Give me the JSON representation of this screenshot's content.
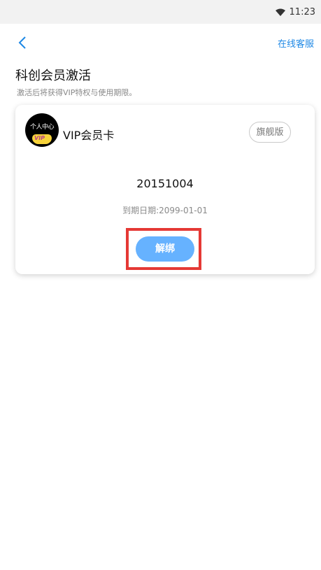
{
  "status_bar": {
    "time": "11:23",
    "wifi_icon": "wifi-icon"
  },
  "nav": {
    "back_icon": "chevron-left-icon",
    "service_label": "在线客服",
    "accent_color": "#1e88e5"
  },
  "page": {
    "title": "科创会员激活",
    "subtitle": "激活后将获得VIP特权与使用期限。"
  },
  "card": {
    "avatar": {
      "text": "个人中心",
      "badge_text": "VIP"
    },
    "title": "VIP会员卡",
    "tier": "旗舰版",
    "number": "20151004",
    "expiry_label": "到期日期:",
    "expiry_date": "2099-01-01",
    "unbind_label": "解绑",
    "button_color": "#66b2ff",
    "highlight_color": "#e53935"
  }
}
